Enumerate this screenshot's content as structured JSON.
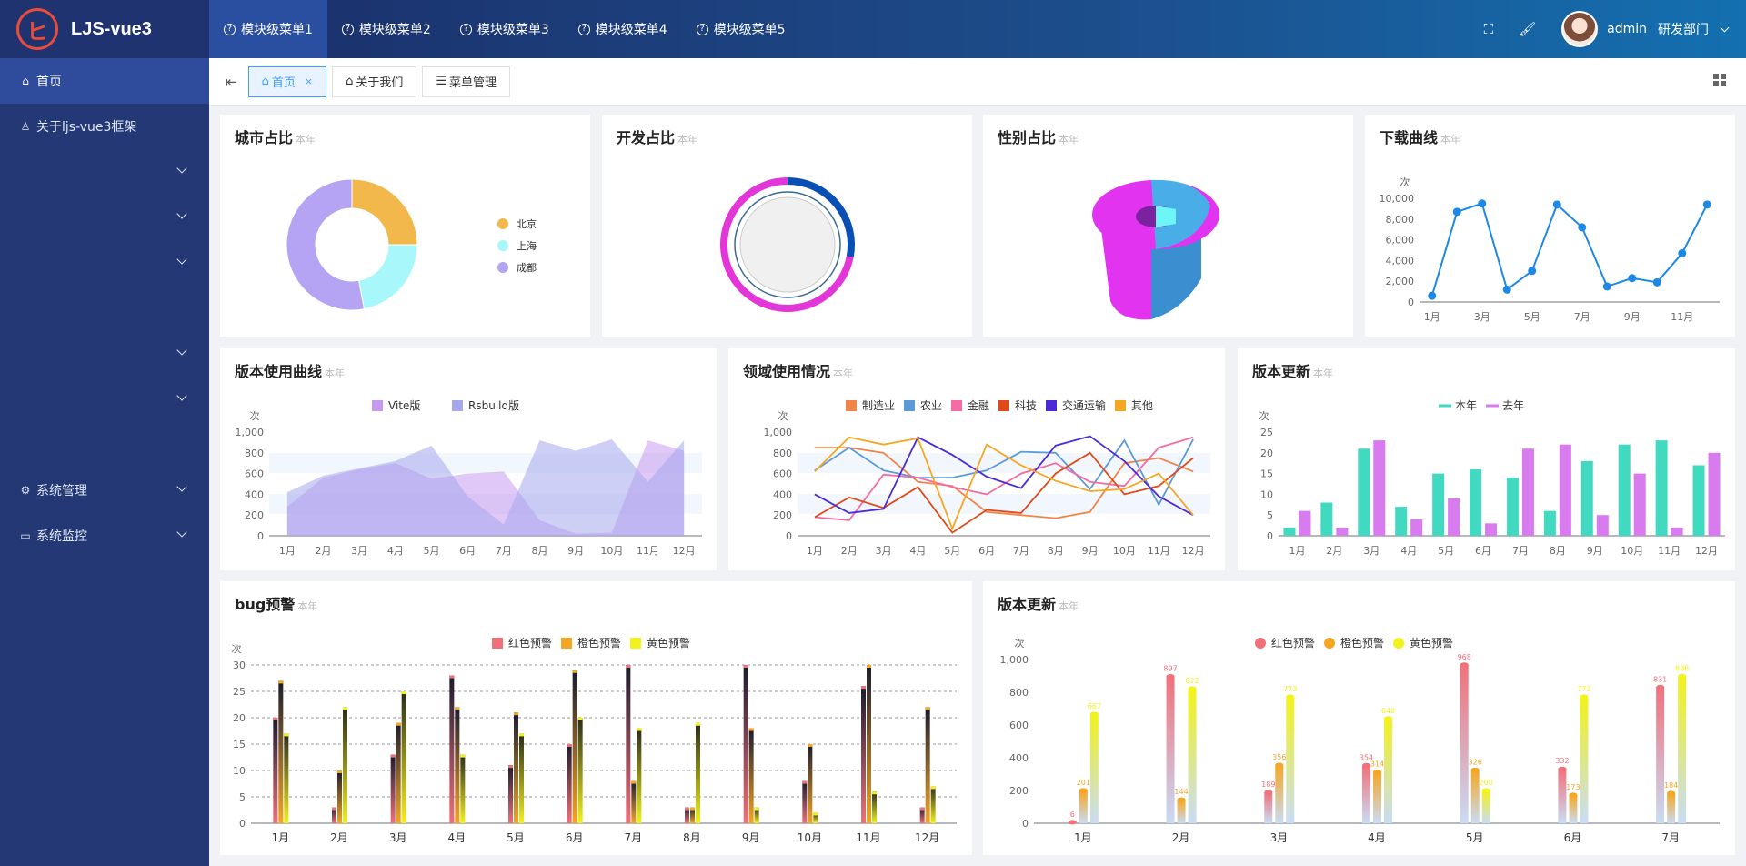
{
  "app": {
    "name": "LJS-vue3"
  },
  "sidebar": {
    "items": [
      {
        "label": "首页",
        "active": true,
        "icon": "home-icon"
      },
      {
        "label": "关于ljs-vue3框架",
        "icon": "user-icon"
      },
      {
        "label": "",
        "chevron": true
      },
      {
        "label": "",
        "chevron": true
      },
      {
        "label": "",
        "chevron": true
      },
      {
        "label": "",
        "chevron": true,
        "gap": true
      },
      {
        "label": "",
        "chevron": true
      },
      {
        "label": "系统管理",
        "chevron": true,
        "icon": "gear-icon",
        "gap": true
      },
      {
        "label": "系统监控",
        "chevron": true,
        "icon": "monitor-icon"
      }
    ]
  },
  "topnav": {
    "items": [
      "模块级菜单1",
      "模块级菜单2",
      "模块级菜单3",
      "模块级菜单4",
      "模块级菜单5"
    ]
  },
  "user": {
    "name": "admin",
    "dept": "研发部门"
  },
  "tabs": [
    {
      "label": "首页",
      "active": true,
      "closable": true
    },
    {
      "label": "关于我们"
    },
    {
      "label": "菜单管理"
    }
  ],
  "panels": {
    "city": {
      "title": "城市占比",
      "sub": "本年"
    },
    "dev": {
      "title": "开发占比",
      "sub": "本年"
    },
    "gender": {
      "title": "性别占比",
      "sub": "本年"
    },
    "download": {
      "title": "下载曲线",
      "sub": "本年"
    },
    "version_use": {
      "title": "版本使用曲线",
      "sub": "本年"
    },
    "domain": {
      "title": "领域使用情况",
      "sub": "本年"
    },
    "version_update": {
      "title": "版本更新",
      "sub": "本年"
    },
    "bug": {
      "title": "bug预警",
      "sub": "本年"
    },
    "version_update2": {
      "title": "版本更新",
      "sub": "本年"
    }
  },
  "chart_data": [
    {
      "id": "city",
      "type": "pie",
      "donut": true,
      "series": [
        {
          "name": "北京",
          "value": 25
        },
        {
          "name": "上海",
          "value": 22
        },
        {
          "name": "成都",
          "value": 53
        }
      ],
      "colors": [
        "#f2b84b",
        "#a8f7fb",
        "#b4a4f3"
      ],
      "legend": "right"
    },
    {
      "id": "dev",
      "type": "pie",
      "ring": true,
      "values": [
        28,
        72
      ],
      "colors": [
        "#0a4fb4",
        "#e236d9"
      ]
    },
    {
      "id": "gender",
      "type": "pie",
      "style": "3d",
      "values": [
        42,
        58
      ],
      "colors": [
        "#49aee8",
        "#e233f0"
      ]
    },
    {
      "id": "download",
      "type": "line",
      "ylabel": "次",
      "categories": [
        "1月",
        "2月",
        "3月",
        "4月",
        "5月",
        "6月",
        "7月",
        "8月",
        "9月",
        "10月",
        "11月",
        "12月"
      ],
      "x_ticks": [
        "1月",
        "3月",
        "5月",
        "7月",
        "9月",
        "11月"
      ],
      "y_ticks": [
        "0",
        "2,000",
        "4,000",
        "6,000",
        "8,000",
        "10,000"
      ],
      "ylim": [
        0,
        10000
      ],
      "values": [
        600,
        8700,
        9500,
        1200,
        3000,
        9400,
        7200,
        1500,
        2300,
        1900,
        4700,
        9400
      ],
      "color": "#1e88e5"
    },
    {
      "id": "version_use",
      "type": "area",
      "ylabel": "次",
      "categories": [
        "1月",
        "2月",
        "3月",
        "4月",
        "5月",
        "6月",
        "7月",
        "8月",
        "9月",
        "10月",
        "11月",
        "12月"
      ],
      "y_ticks": [
        "0",
        "200",
        "400",
        "600",
        "800",
        "1,000"
      ],
      "ylim": [
        0,
        1000
      ],
      "series": [
        {
          "name": "Vite版",
          "values": [
            280,
            560,
            640,
            700,
            550,
            600,
            620,
            150,
            20,
            30,
            920,
            820
          ],
          "color": "#c79af0"
        },
        {
          "name": "Rsbuild版",
          "values": [
            420,
            580,
            650,
            720,
            870,
            380,
            110,
            920,
            820,
            930,
            520,
            920
          ],
          "color": "#a5a8ec"
        }
      ]
    },
    {
      "id": "domain",
      "type": "line",
      "ylabel": "次",
      "categories": [
        "1月",
        "2月",
        "3月",
        "4月",
        "5月",
        "6月",
        "7月",
        "8月",
        "9月",
        "10月",
        "11月",
        "12月"
      ],
      "y_ticks": [
        "0",
        "200",
        "400",
        "600",
        "800",
        "1,000"
      ],
      "ylim": [
        0,
        1000
      ],
      "series": [
        {
          "name": "制造业",
          "values": [
            850,
            850,
            800,
            520,
            480,
            230,
            200,
            170,
            230,
            700,
            750,
            620
          ],
          "color": "#f0844a"
        },
        {
          "name": "农业",
          "values": [
            630,
            850,
            630,
            560,
            560,
            630,
            810,
            800,
            450,
            920,
            300,
            930
          ],
          "color": "#5b9bd8"
        },
        {
          "name": "金融",
          "values": [
            180,
            150,
            590,
            560,
            470,
            400,
            600,
            700,
            520,
            480,
            850,
            950
          ],
          "color": "#f56ba6"
        },
        {
          "name": "科技",
          "values": [
            180,
            370,
            270,
            470,
            30,
            250,
            220,
            600,
            800,
            400,
            480,
            750
          ],
          "color": "#e04a1a"
        },
        {
          "name": "交通运输",
          "values": [
            400,
            220,
            260,
            950,
            780,
            570,
            460,
            870,
            960,
            720,
            380,
            200
          ],
          "color": "#4c2ad6"
        },
        {
          "name": "其他",
          "values": [
            620,
            950,
            880,
            940,
            70,
            880,
            680,
            530,
            430,
            450,
            600,
            200
          ],
          "color": "#f5a623"
        }
      ]
    },
    {
      "id": "version_update",
      "type": "bar",
      "ylabel": "次",
      "categories": [
        "1月",
        "2月",
        "3月",
        "4月",
        "5月",
        "6月",
        "7月",
        "8月",
        "9月",
        "10月",
        "11月",
        "12月"
      ],
      "y_ticks": [
        "0",
        "5",
        "10",
        "15",
        "20",
        "25"
      ],
      "ylim": [
        0,
        25
      ],
      "series": [
        {
          "name": "本年",
          "values": [
            2,
            8,
            21,
            7,
            15,
            16,
            14,
            6,
            18,
            22,
            23,
            17
          ],
          "color": "#41d9c0"
        },
        {
          "name": "去年",
          "values": [
            6,
            2,
            23,
            4,
            9,
            3,
            21,
            22,
            5,
            15,
            2,
            20
          ],
          "color": "#d77bee"
        }
      ]
    },
    {
      "id": "bug",
      "type": "bar",
      "ylabel": "次",
      "categories": [
        "1月",
        "2月",
        "3月",
        "4月",
        "5月",
        "6月",
        "7月",
        "8月",
        "9月",
        "10月",
        "11月",
        "12月"
      ],
      "y_ticks": [
        "0",
        "5",
        "10",
        "15",
        "20",
        "25",
        "30"
      ],
      "ylim": [
        0,
        30
      ],
      "series": [
        {
          "name": "红色预警",
          "values": [
            [
              20,
              3,
              13,
              28,
              11,
              15,
              30,
              3,
              30,
              8,
              26,
              3
            ]
          ],
          "color": "#f0717a"
        },
        {
          "name": "橙色预警",
          "values": [
            [
              27,
              10,
              19,
              22,
              21,
              29,
              8,
              3,
              18,
              15,
              30,
              22
            ]
          ],
          "color": "#f5a623"
        },
        {
          "name": "黄色预警",
          "values": [
            [
              17,
              22,
              25,
              13,
              17,
              20,
              18,
              19,
              3,
              2,
              6,
              7
            ]
          ],
          "color": "#f2f21c"
        }
      ]
    },
    {
      "id": "version_update2",
      "type": "bar",
      "ylabel": "次",
      "categories": [
        "1月",
        "2月",
        "3月",
        "4月",
        "5月",
        "6月",
        "7月"
      ],
      "y_ticks": [
        "0",
        "200",
        "400",
        "600",
        "800",
        "1,000"
      ],
      "ylim": [
        0,
        1000
      ],
      "series": [
        {
          "name": "红色预警",
          "values": [
            6,
            897,
            189,
            354,
            968,
            332,
            831
          ],
          "color": "#f0717a"
        },
        {
          "name": "橙色预警",
          "values": [
            201,
            144,
            356,
            314,
            326,
            173,
            184
          ],
          "color": "#f5a623"
        },
        {
          "name": "黄色预警",
          "values": [
            667,
            822,
            773,
            640,
            200,
            772,
            898
          ],
          "color": "#f2f21c"
        }
      ]
    }
  ]
}
